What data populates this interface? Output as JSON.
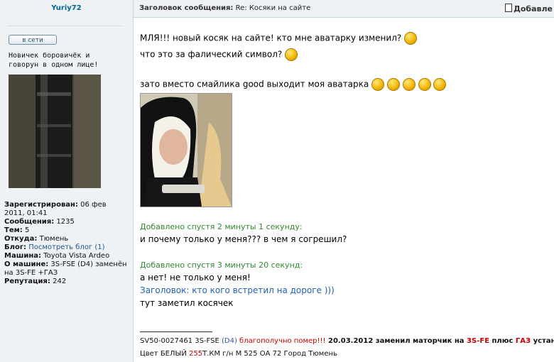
{
  "user": {
    "name": "Yuriy72",
    "online_label": "в сети",
    "rank": "Новичек боровичёк и говорун в одном лице!",
    "details": [
      {
        "label": "Зарегистрирован:",
        "value": "06 фев 2011, 01:41"
      },
      {
        "label": "Сообщения:",
        "value": "1235"
      },
      {
        "label": "Тем:",
        "value": "5"
      },
      {
        "label": "Откуда:",
        "value": "Тюмень"
      },
      {
        "label": "Блог:",
        "value": "Посмотреть блог (1)"
      },
      {
        "label": "Машина:",
        "value": "Toyota Vista Ardeo"
      },
      {
        "label": "О машине:",
        "value": "3S-FSE (D4) заменён на 3S-FE +ГАЗ"
      },
      {
        "label": "Репутация:",
        "value": "242"
      }
    ]
  },
  "header": {
    "subject_label": "Заголовок сообщения:",
    "subject_value": "Re: Косяки на сайте",
    "add_label": "Добавле"
  },
  "post": {
    "line1": "МЛЯ!!! новый косяк на сайте! кто мне аватарку изменил?",
    "line2": "что это за фалический символ?",
    "line3": "зато вместо смайлика good выходит моя аватарка",
    "added1": "Добавлено спустя 2 минуты 1 секунду:",
    "line4": "и почему только у меня??? в чем я согрешил?",
    "added2": "Добавлено спустя 3 минуты 20 секунд:",
    "line5": "а нет! не только у меня!",
    "link": "Заголовок: кто кого встретил на дороге )))",
    "line6": "тут заметил косячек"
  },
  "signature": {
    "p1": "SV50-0027461 3S-FSE ",
    "p2": "(D4)",
    "p3": " благополучно помер!!!",
    "p4": " 20.03.2012 заменил маторчик на ",
    "p5": "3S-FE",
    "p6": " плюс ",
    "p7": "ГАЗ",
    "p8": " установил",
    "q1": "Цвет БЕЛЫЙ ",
    "q2": "255",
    "q3": "Т.КМ г/н М 525 ОА 72 Город Тюмень"
  },
  "colors": {
    "username": "#006699",
    "added_text": "#2f8a2f",
    "link": "#1f5fbf",
    "signature_red": "#cc0000"
  }
}
